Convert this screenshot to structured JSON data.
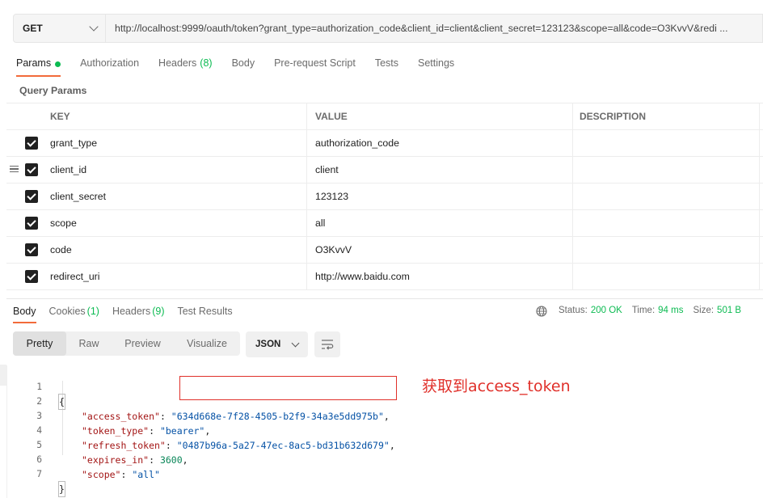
{
  "request": {
    "method": "GET",
    "url": "http://localhost:9999/oauth/token?grant_type=authorization_code&client_id=client&client_secret=123123&scope=all&code=O3KvvV&redi ..."
  },
  "tabs": [
    {
      "label": "Params",
      "active": true,
      "dot": true
    },
    {
      "label": "Authorization"
    },
    {
      "label": "Headers",
      "count": "(8)"
    },
    {
      "label": "Body"
    },
    {
      "label": "Pre-request Script"
    },
    {
      "label": "Tests"
    },
    {
      "label": "Settings"
    }
  ],
  "query_params": {
    "title": "Query Params",
    "headers": [
      "KEY",
      "VALUE",
      "DESCRIPTION"
    ],
    "rows": [
      {
        "key": "grant_type",
        "value": "authorization_code",
        "checked": true
      },
      {
        "key": "client_id",
        "value": "client",
        "checked": true
      },
      {
        "key": "client_secret",
        "value": "123123",
        "checked": true
      },
      {
        "key": "scope",
        "value": "all",
        "checked": true
      },
      {
        "key": "code",
        "value": "O3KvvV",
        "checked": true
      },
      {
        "key": "redirect_uri",
        "value": "http://www.baidu.com",
        "checked": true
      }
    ]
  },
  "response": {
    "tabs": [
      {
        "label": "Body",
        "active": true
      },
      {
        "label": "Cookies",
        "count": "(1)"
      },
      {
        "label": "Headers",
        "count": "(9)"
      },
      {
        "label": "Test Results"
      }
    ],
    "status_label": "Status:",
    "status_value": "200 OK",
    "time_label": "Time:",
    "time_value": "94 ms",
    "size_label": "Size:",
    "size_value": "501 B",
    "view_tabs": [
      "Pretty",
      "Raw",
      "Preview",
      "Visualize"
    ],
    "format": "JSON",
    "code_lines": [
      {
        "n": "1",
        "open": "{"
      },
      {
        "n": "2",
        "key": "\"access_token\"",
        "sep": ": ",
        "val": "\"634d668e-7f28-4505-b2f9-34a3e5dd975b\"",
        "type": "s",
        "comma": ","
      },
      {
        "n": "3",
        "key": "\"token_type\"",
        "sep": ": ",
        "val": "\"bearer\"",
        "type": "s",
        "comma": ","
      },
      {
        "n": "4",
        "key": "\"refresh_token\"",
        "sep": ": ",
        "val": "\"0487b96a-5a27-47ec-8ac5-bd31b632d679\"",
        "type": "s",
        "comma": ","
      },
      {
        "n": "5",
        "key": "\"expires_in\"",
        "sep": ": ",
        "val": "3600",
        "type": "n",
        "comma": ","
      },
      {
        "n": "6",
        "key": "\"scope\"",
        "sep": ": ",
        "val": "\"all\"",
        "type": "s",
        "comma": ""
      },
      {
        "n": "7",
        "open": "}"
      }
    ]
  },
  "annotation": {
    "text": "获取到access_token",
    "color": "#e0302a"
  },
  "colors": {
    "accent": "#f26b3a",
    "success": "#0cbb52"
  }
}
